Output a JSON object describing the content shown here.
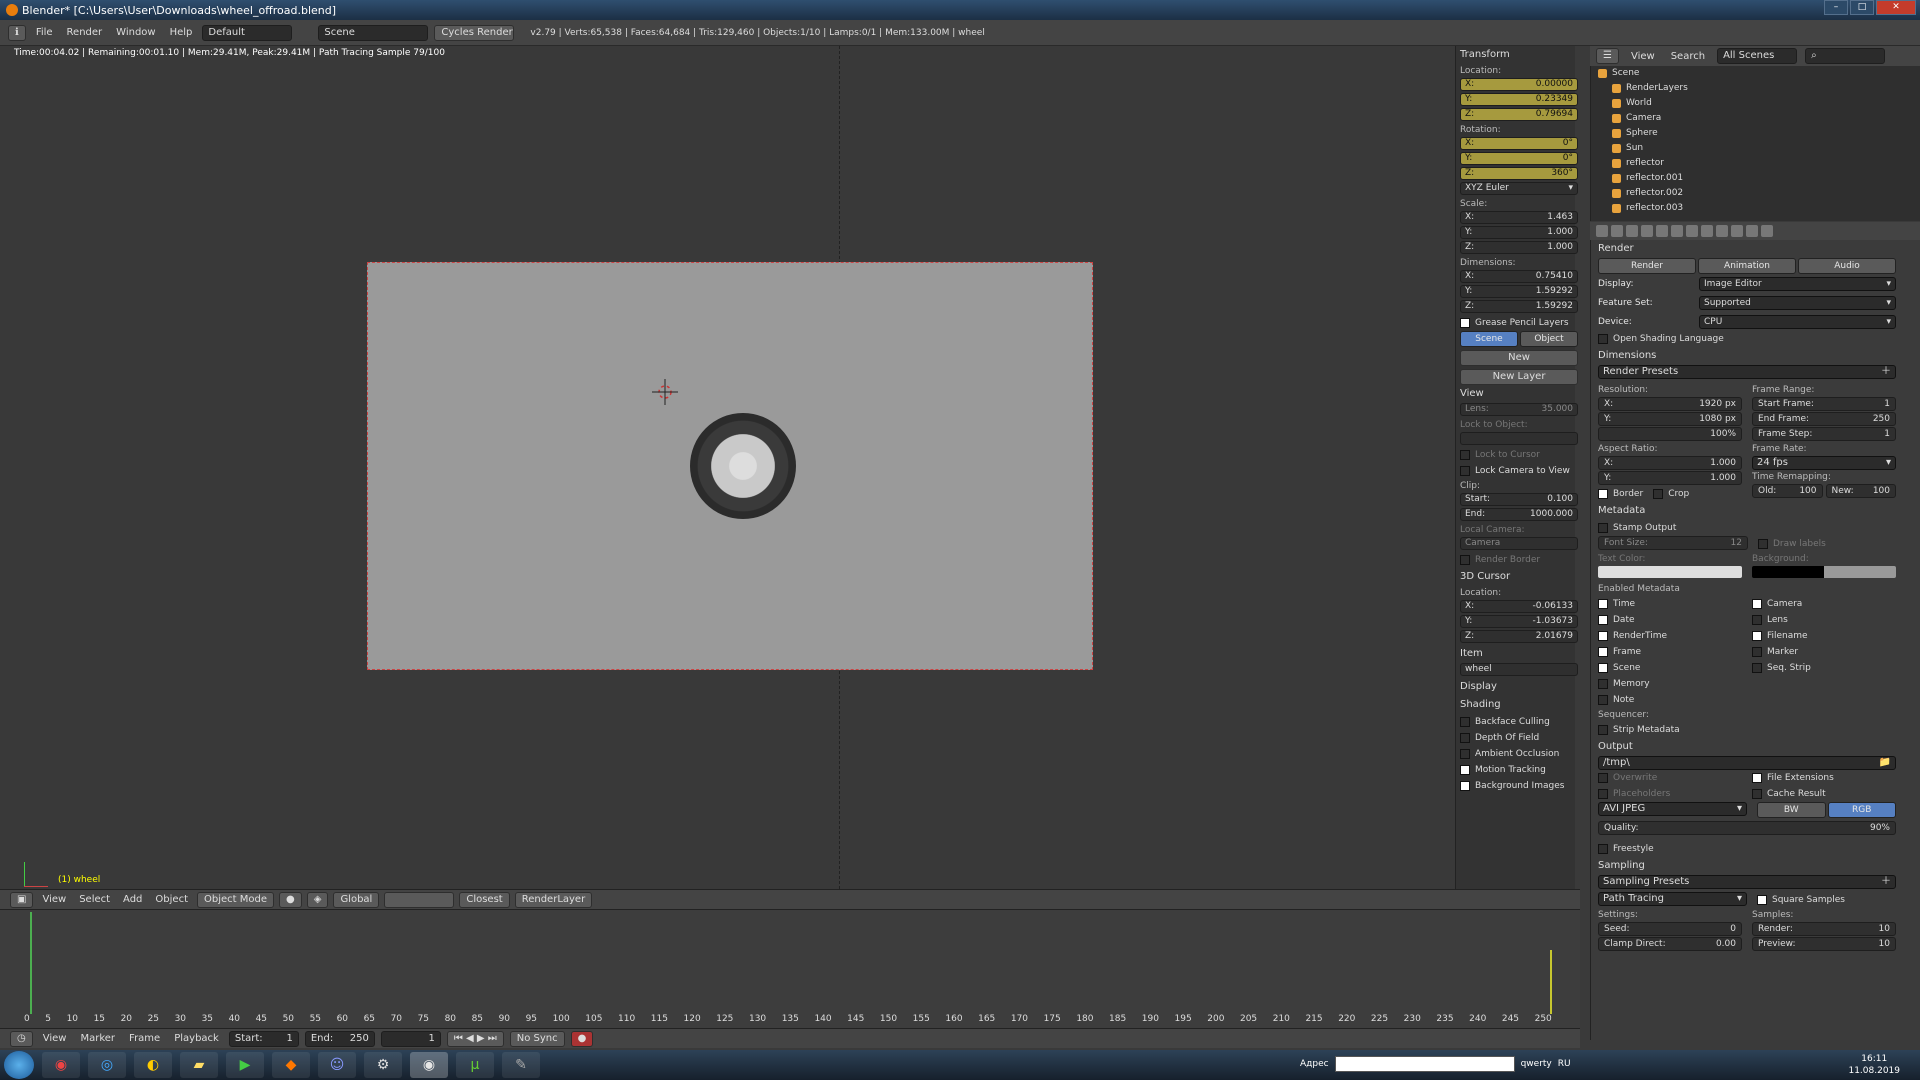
{
  "titlebar": {
    "title": "Blender* [C:\\Users\\User\\Downloads\\wheel_offroad.blend]"
  },
  "topbar": {
    "menus": [
      "File",
      "Render",
      "Window",
      "Help"
    ],
    "layout": "Default",
    "scene": "Scene",
    "engine": "Cycles Render",
    "stats": "v2.79 | Verts:65,538 | Faces:64,684 | Tris:129,460 | Objects:1/10 | Lamps:0/1 | Mem:133.00M | wheel"
  },
  "viewport": {
    "info": "Time:00:04.02 | Remaining:00:01.10 | Mem:29.41M, Peak:29.41M | Path Tracing Sample 79/100",
    "object_label": "(1) wheel"
  },
  "npanel": {
    "transform": "Transform",
    "location": "Location:",
    "loc": [
      {
        "a": "X:",
        "v": "0.00000"
      },
      {
        "a": "Y:",
        "v": "0.23349"
      },
      {
        "a": "Z:",
        "v": "0.79694"
      }
    ],
    "rotation": "Rotation:",
    "rot": [
      {
        "a": "X:",
        "v": "0°"
      },
      {
        "a": "Y:",
        "v": "0°"
      },
      {
        "a": "Z:",
        "v": "360°"
      }
    ],
    "euler": "XYZ Euler",
    "scale": "Scale:",
    "scl": [
      {
        "a": "X:",
        "v": "1.463"
      },
      {
        "a": "Y:",
        "v": "1.000"
      },
      {
        "a": "Z:",
        "v": "1.000"
      }
    ],
    "dimensions": "Dimensions:",
    "dim": [
      {
        "a": "X:",
        "v": "0.75410"
      },
      {
        "a": "Y:",
        "v": "1.59292"
      },
      {
        "a": "Z:",
        "v": "1.59292"
      }
    ],
    "gp_layers": "Grease Pencil Layers",
    "gp_scene": "Scene",
    "gp_object": "Object",
    "gp_new": "New",
    "gp_new_layer": "New Layer",
    "view": "View",
    "lens": "Lens:",
    "lens_v": "35.000",
    "lock_obj": "Lock to Object:",
    "lock_cursor": "Lock to Cursor",
    "lock_cam": "Lock Camera to View",
    "clip": "Clip:",
    "clip_start": "Start:",
    "clip_start_v": "0.100",
    "clip_end": "End:",
    "clip_end_v": "1000.000",
    "local_cam": "Local Camera:",
    "camera": "Camera",
    "render_border": "Render Border",
    "cursor": "3D Cursor",
    "cursor_loc": "Location:",
    "cur": [
      {
        "a": "X:",
        "v": "-0.06133"
      },
      {
        "a": "Y:",
        "v": "-1.03673"
      },
      {
        "a": "Z:",
        "v": "2.01679"
      }
    ],
    "item": "Item",
    "item_name": "wheel",
    "display": "Display",
    "shading": "Shading",
    "backface": "Backface Culling",
    "dof": "Depth Of Field",
    "ao": "Ambient Occlusion",
    "motion": "Motion Tracking",
    "bg_images": "Background Images"
  },
  "vp_toolbar": {
    "menus": [
      "View",
      "Select",
      "Add",
      "Object"
    ],
    "mode": "Object Mode",
    "orient": "Global",
    "snap": "Closest",
    "layer": "RenderLayer"
  },
  "timeline": {
    "ticks": [
      "0",
      "5",
      "10",
      "15",
      "20",
      "25",
      "30",
      "35",
      "40",
      "45",
      "50",
      "55",
      "60",
      "65",
      "70",
      "75",
      "80",
      "85",
      "90",
      "95",
      "100",
      "105",
      "110",
      "115",
      "120",
      "125",
      "130",
      "135",
      "140",
      "145",
      "150",
      "155",
      "160",
      "165",
      "170",
      "175",
      "180",
      "185",
      "190",
      "195",
      "200",
      "205",
      "210",
      "215",
      "220",
      "225",
      "230",
      "235",
      "240",
      "245",
      "250"
    ],
    "menus": [
      "View",
      "Marker",
      "Frame",
      "Playback"
    ],
    "start": "Start:",
    "start_v": "1",
    "end": "End:",
    "end_v": "250",
    "cur": "1",
    "sync": "No Sync"
  },
  "outliner": {
    "menus": [
      "View",
      "Search"
    ],
    "scenes": "All Scenes",
    "items": [
      "Scene",
      "RenderLayers",
      "World",
      "Camera",
      "Sphere",
      "Sun",
      "reflector",
      "reflector.001",
      "reflector.002",
      "reflector.003"
    ]
  },
  "props": {
    "render": "Render",
    "tab_render": "Render",
    "tab_anim": "Animation",
    "tab_audio": "Audio",
    "display": "Display:",
    "display_v": "Image Editor",
    "feature": "Feature Set:",
    "feature_v": "Supported",
    "device": "Device:",
    "device_v": "CPU",
    "osl": "Open Shading Language",
    "dimensions": "Dimensions",
    "presets": "Render Presets",
    "resolution": "Resolution:",
    "res_x": "X:",
    "res_x_v": "1920 px",
    "res_y": "Y:",
    "res_y_v": "1080 px",
    "res_pct": "100%",
    "frame_range": "Frame Range:",
    "start_frame": "Start Frame:",
    "start_frame_v": "1",
    "end_frame": "End Frame:",
    "end_frame_v": "250",
    "frame_step": "Frame Step:",
    "frame_step_v": "1",
    "aspect": "Aspect Ratio:",
    "asp_x": "X:",
    "asp_x_v": "1.000",
    "asp_y": "Y:",
    "asp_y_v": "1.000",
    "frame_rate": "Frame Rate:",
    "fps": "24 fps",
    "time_remap": "Time Remapping:",
    "old": "Old:",
    "old_v": "100",
    "new": "New:",
    "new_v": "100",
    "border": "Border",
    "crop": "Crop",
    "metadata": "Metadata",
    "stamp": "Stamp Output",
    "draw_labels": "Draw labels",
    "font_size": "Font Size:",
    "font_size_v": "12",
    "text_color": "Text Color:",
    "background": "Background:",
    "enabled_meta": "Enabled Metadata",
    "meta_left": [
      "Time",
      "Date",
      "RenderTime",
      "Frame",
      "Scene",
      "Memory",
      "Note"
    ],
    "meta_right": [
      "Camera",
      "Lens",
      "Filename",
      "Marker",
      "Seq. Strip"
    ],
    "sequencer": "Sequencer:",
    "strip_meta": "Strip Metadata",
    "output": "Output",
    "out_path": "/tmp\\",
    "overwrite": "Overwrite",
    "placeholders": "Placeholders",
    "file_ext": "File Extensions",
    "cache": "Cache Result",
    "format": "AVI JPEG",
    "bw": "BW",
    "rgb": "RGB",
    "quality": "Quality:",
    "quality_v": "90%",
    "freestyle": "Freestyle",
    "sampling": "Sampling",
    "sampling_presets": "Sampling Presets",
    "integrator": "Path Tracing",
    "square": "Square Samples",
    "settings": "Settings:",
    "samples": "Samples:",
    "seed": "Seed:",
    "seed_v": "0",
    "clamp": "Clamp Direct:",
    "clamp_v": "0.00",
    "s_render": "Render:",
    "s_render_v": "10",
    "s_preview": "Preview:",
    "s_preview_v": "10"
  },
  "taskbar": {
    "address": "Адрес",
    "kb": "qwerty",
    "lang": "RU",
    "time": "16:11",
    "date": "11.08.2019"
  }
}
